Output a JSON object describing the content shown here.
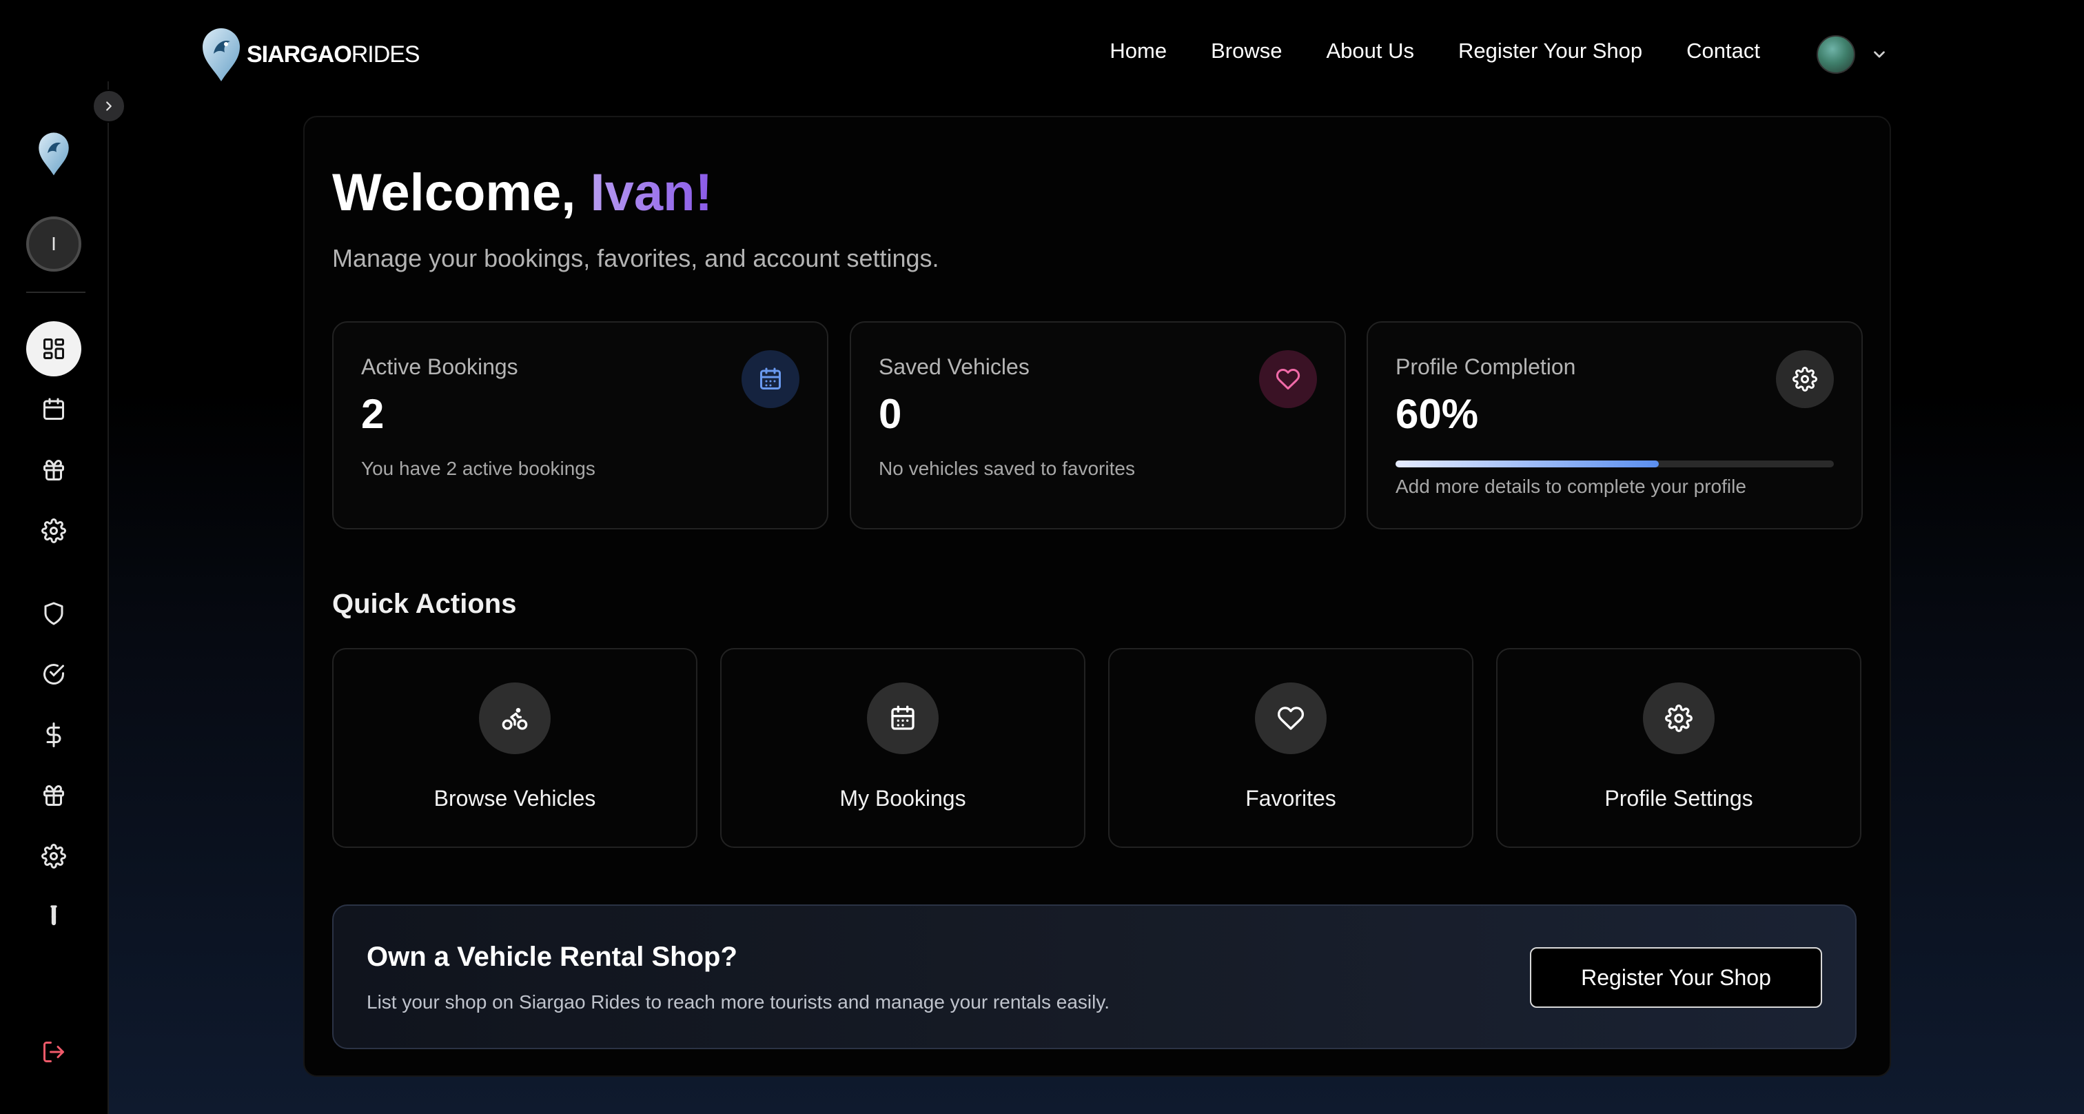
{
  "brand": {
    "name_bold": "SIARGAO",
    "name_light": "RIDES"
  },
  "nav": {
    "links": [
      "Home",
      "Browse",
      "About Us",
      "Register Your Shop",
      "Contact"
    ]
  },
  "sidebar": {
    "user_initial": "I",
    "items": [
      {
        "icon": "dashboard-grid-icon",
        "active": true
      },
      {
        "icon": "calendar-icon"
      },
      {
        "icon": "gift-icon"
      },
      {
        "icon": "gear-icon"
      },
      {
        "icon": "shield-icon"
      },
      {
        "icon": "check-circle-icon"
      },
      {
        "icon": "dollar-icon"
      },
      {
        "icon": "gift-icon"
      },
      {
        "icon": "gear-icon"
      },
      {
        "icon": "test-tube-icon"
      },
      {
        "icon": "logout-icon",
        "color": "#f05a6a"
      }
    ]
  },
  "welcome": {
    "greeting": "Welcome,",
    "name": "Ivan!",
    "subtitle": "Manage your bookings, favorites, and account settings."
  },
  "stats": [
    {
      "title": "Active Bookings",
      "value": "2",
      "desc": "You have 2 active bookings",
      "icon": "calendar-icon",
      "icon_bg": "#15233f",
      "icon_color": "#6a9af0"
    },
    {
      "title": "Saved Vehicles",
      "value": "0",
      "desc": "No vehicles saved to favorites",
      "icon": "heart-icon",
      "icon_bg": "#3a1225",
      "icon_color": "#f06aa8"
    },
    {
      "title": "Profile Completion",
      "value": "60%",
      "desc": "Add more details to complete your profile",
      "icon": "gear-icon",
      "icon_bg": "#2a2a2a",
      "icon_color": "#ffffff",
      "progress": 0.6
    }
  ],
  "quick_actions": {
    "title": "Quick Actions",
    "items": [
      {
        "label": "Browse Vehicles",
        "icon": "bicycle-icon"
      },
      {
        "label": "My Bookings",
        "icon": "calendar-icon"
      },
      {
        "label": "Favorites",
        "icon": "heart-icon"
      },
      {
        "label": "Profile Settings",
        "icon": "gear-icon"
      }
    ]
  },
  "promo": {
    "title": "Own a Vehicle Rental Shop?",
    "desc": "List your shop on Siargao Rides to reach more tourists and manage your rentals easily.",
    "button": "Register Your Shop"
  }
}
